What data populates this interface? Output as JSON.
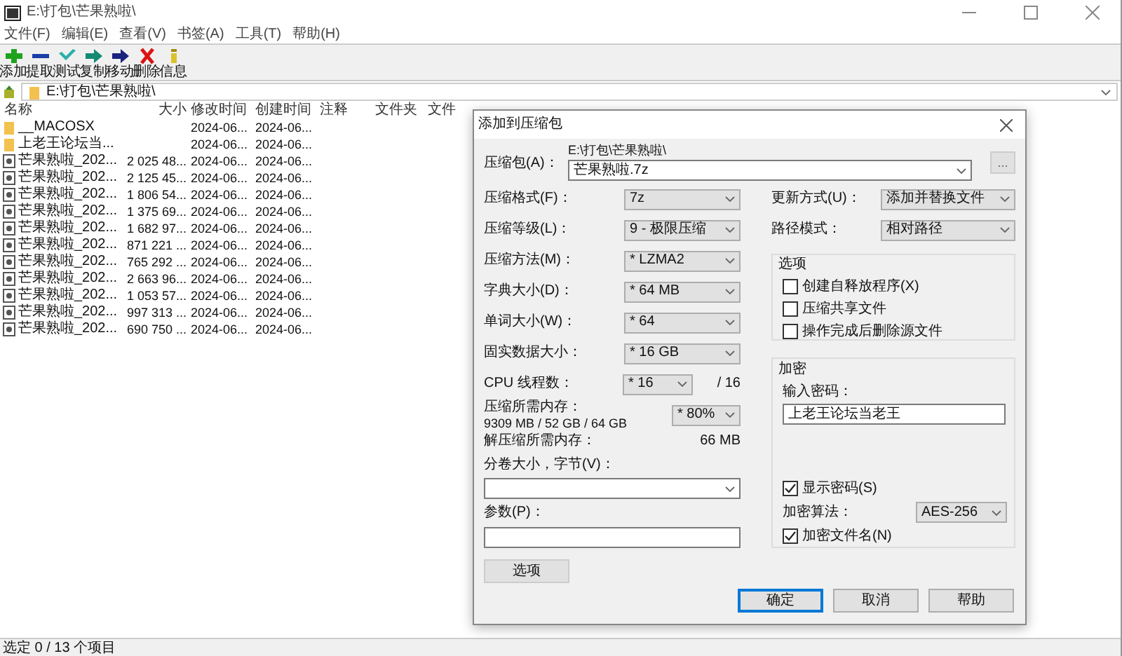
{
  "window": {
    "title": "E:\\打包\\芒果熟啦\\"
  },
  "menu": [
    "文件(F)",
    "编辑(E)",
    "查看(V)",
    "书签(A)",
    "工具(T)",
    "帮助(H)"
  ],
  "toolbar": [
    {
      "kind": "add",
      "label": "添加"
    },
    {
      "kind": "extract",
      "label": "提取"
    },
    {
      "kind": "test",
      "label": "测试"
    },
    {
      "kind": "copy",
      "label": "复制"
    },
    {
      "kind": "move",
      "label": "移动"
    },
    {
      "kind": "delete",
      "label": "删除"
    },
    {
      "kind": "info",
      "label": "信息"
    }
  ],
  "address": "E:\\打包\\芒果熟啦\\",
  "columns": [
    "名称",
    "大小",
    "修改时间",
    "创建时间",
    "注释",
    "文件夹",
    "文件"
  ],
  "rows": [
    {
      "kind": "folder",
      "name": "__MACOSX",
      "size": "",
      "modified": "2024-06...",
      "created": "2024-06..."
    },
    {
      "kind": "folder",
      "name": "上老王论坛当...",
      "size": "",
      "modified": "2024-06...",
      "created": "2024-06..."
    },
    {
      "kind": "file",
      "name": "芒果熟啦_202...",
      "size": "2 025 48...",
      "modified": "2024-06...",
      "created": "2024-06..."
    },
    {
      "kind": "file",
      "name": "芒果熟啦_202...",
      "size": "2 125 45...",
      "modified": "2024-06...",
      "created": "2024-06..."
    },
    {
      "kind": "file",
      "name": "芒果熟啦_202...",
      "size": "1 806 54...",
      "modified": "2024-06...",
      "created": "2024-06..."
    },
    {
      "kind": "file",
      "name": "芒果熟啦_202...",
      "size": "1 375 69...",
      "modified": "2024-06...",
      "created": "2024-06..."
    },
    {
      "kind": "file",
      "name": "芒果熟啦_202...",
      "size": "1 682 97...",
      "modified": "2024-06...",
      "created": "2024-06..."
    },
    {
      "kind": "file",
      "name": "芒果熟啦_202...",
      "size": "871 221 ...",
      "modified": "2024-06...",
      "created": "2024-06..."
    },
    {
      "kind": "file",
      "name": "芒果熟啦_202...",
      "size": "765 292 ...",
      "modified": "2024-06...",
      "created": "2024-06..."
    },
    {
      "kind": "file",
      "name": "芒果熟啦_202...",
      "size": "2 663 96...",
      "modified": "2024-06...",
      "created": "2024-06..."
    },
    {
      "kind": "file",
      "name": "芒果熟啦_202...",
      "size": "1 053 57...",
      "modified": "2024-06...",
      "created": "2024-06..."
    },
    {
      "kind": "file",
      "name": "芒果熟啦_202...",
      "size": "997 313 ...",
      "modified": "2024-06...",
      "created": "2024-06..."
    },
    {
      "kind": "file",
      "name": "芒果熟啦_202...",
      "size": "690 750 ...",
      "modified": "2024-06...",
      "created": "2024-06..."
    }
  ],
  "status_bar": "选定 0 / 13 个项目",
  "dialog": {
    "title": "添加到压缩包",
    "archive": {
      "label": "压缩包(A)：",
      "path": "E:\\打包\\芒果熟啦\\",
      "value": "芒果熟啦.7z",
      "browse": "..."
    },
    "settings": [
      {
        "label": "压缩格式(F)：",
        "value": "7z"
      },
      {
        "label": "压缩等级(L)：",
        "value": "9 - 极限压缩"
      },
      {
        "label": "压缩方法(M)：",
        "value": "* LZMA2"
      },
      {
        "label": "字典大小(D)：",
        "value": "* 64 MB"
      },
      {
        "label": "单词大小(W)：",
        "value": "* 64"
      },
      {
        "label": "固实数据大小：",
        "value": "* 16 GB"
      }
    ],
    "threads": {
      "label": "CPU 线程数：",
      "value": "* 16",
      "max": "/ 16"
    },
    "memory": {
      "label": "压缩所需内存：",
      "detail": "9309 MB / 52 GB / 64 GB",
      "value": "* 80%"
    },
    "decompress": {
      "label": "解压缩所需内存：",
      "value": "66 MB"
    },
    "volume": {
      "label": "分卷大小，字节(V)："
    },
    "params": {
      "label": "参数(P)："
    },
    "options_button": "选项",
    "update": {
      "label": "更新方式(U)：",
      "value": "添加并替换文件"
    },
    "path_mode": {
      "label": "路径模式：",
      "value": "相对路径"
    },
    "options": {
      "title": "选项",
      "items": [
        {
          "label": "创建自释放程序(X)",
          "checked": false
        },
        {
          "label": "压缩共享文件",
          "checked": false
        },
        {
          "label": "操作完成后删除源文件",
          "checked": false
        }
      ]
    },
    "encryption": {
      "title": "加密",
      "password_label": "输入密码：",
      "password": "上老王论坛当老王",
      "show_password": {
        "label": "显示密码(S)",
        "checked": true
      },
      "method_label": "加密算法：",
      "method": "AES-256",
      "encrypt_names": {
        "label": "加密文件名(N)",
        "checked": true
      }
    },
    "buttons": [
      {
        "label": "确定",
        "default": true
      },
      {
        "label": "取消",
        "default": false
      },
      {
        "label": "帮助",
        "default": false
      }
    ]
  }
}
